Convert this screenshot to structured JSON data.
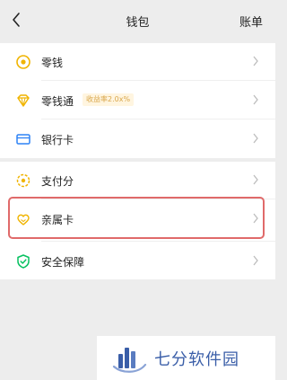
{
  "header": {
    "title": "钱包",
    "right_action": "账单"
  },
  "groups": [
    {
      "items": [
        {
          "label": "零钱",
          "icon": "coin-icon"
        },
        {
          "label": "零钱通",
          "icon": "diamond-icon",
          "badge": "收益率2.0x%"
        },
        {
          "label": "银行卡",
          "icon": "bank-card-icon"
        }
      ]
    },
    {
      "items": [
        {
          "label": "支付分",
          "icon": "pay-score-icon"
        },
        {
          "label": "亲属卡",
          "icon": "family-card-icon",
          "highlighted": true
        },
        {
          "label": "安全保障",
          "icon": "shield-icon"
        }
      ]
    }
  ],
  "colors": {
    "page_background": "#ededed",
    "card_background": "#ffffff",
    "icon_accent": "#f0b400",
    "bank_icon": "#2d82f5",
    "shield_icon": "#07c160",
    "highlight_border": "#e06a6a",
    "watermark_text": "#3a5ea8"
  },
  "watermark": {
    "text": "七分软件园"
  }
}
